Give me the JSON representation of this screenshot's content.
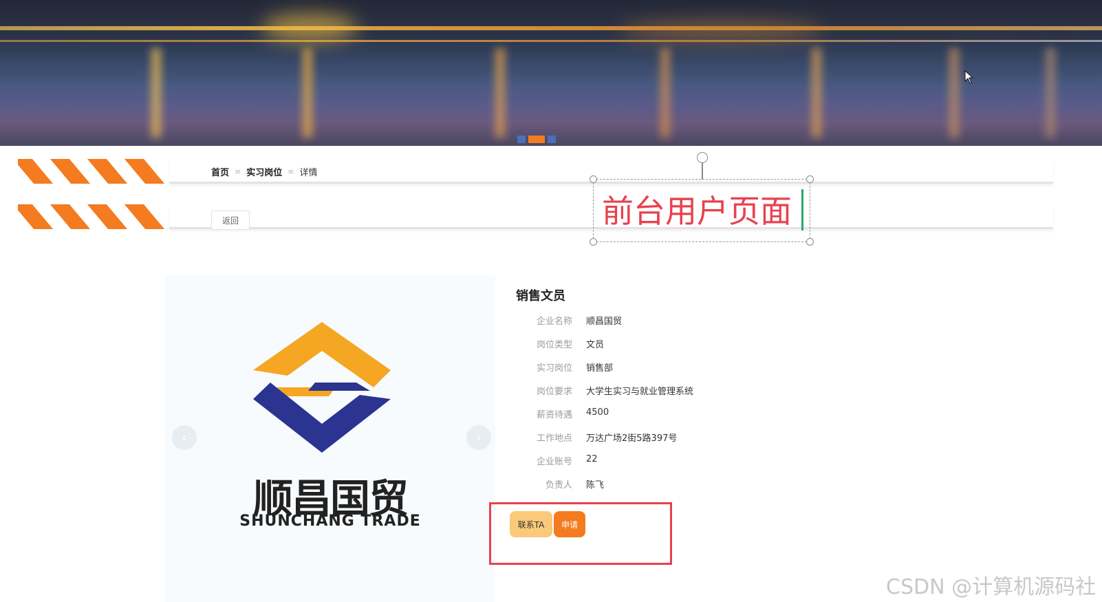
{
  "breadcrumb": {
    "home": "首页",
    "section": "实习岗位",
    "current": "详情",
    "separator": "≡"
  },
  "back_button": "返回",
  "annotation": {
    "text": "前台用户页面",
    "color": "#e8414e"
  },
  "carousel": {
    "prev_glyph": "‹",
    "next_glyph": "›",
    "active_dot": 2,
    "dot_count": 3
  },
  "logo": {
    "name_cn": "顺昌国贸",
    "name_en": "SHUNCHANG TRADE"
  },
  "job": {
    "title": "销售文员",
    "fields": [
      {
        "label": "企业名称",
        "value": "顺昌国贸"
      },
      {
        "label": "岗位类型",
        "value": "文员"
      },
      {
        "label": "实习岗位",
        "value": "销售部"
      },
      {
        "label": "岗位要求",
        "value": "大学生实习与就业管理系统"
      },
      {
        "label": "薪资待遇",
        "value": "4500"
      },
      {
        "label": "工作地点",
        "value": "万达广场2街5路397号"
      },
      {
        "label": "企业账号",
        "value": "22"
      },
      {
        "label": "负责人",
        "value": "陈飞"
      }
    ]
  },
  "actions": {
    "contact": "联系TA",
    "apply": "申请"
  },
  "colors": {
    "accent_orange": "#f47b20",
    "contact_yellow": "#fbc97a",
    "highlight_red": "#e8414e"
  },
  "watermark": "CSDN @计算机源码社"
}
